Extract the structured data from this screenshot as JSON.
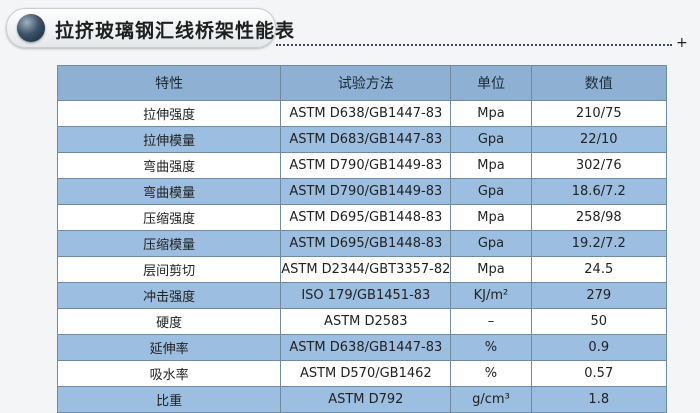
{
  "title": "拉挤玻璃钢汇线桥架性能表",
  "corner_mark": "+",
  "table": {
    "headers": [
      "特性",
      "试验方法",
      "单位",
      "数值"
    ],
    "rows": [
      {
        "property": "拉伸强度",
        "method": "ASTM  D638/GB1447-83",
        "unit": "Mpa",
        "value": "210/75"
      },
      {
        "property": "拉伸模量",
        "method": "ASTM  D683/GB1447-83",
        "unit": "Gpa",
        "value": "22/10"
      },
      {
        "property": "弯曲强度",
        "method": "ASTM  D790/GB1449-83",
        "unit": "Mpa",
        "value": "302/76"
      },
      {
        "property": "弯曲模量",
        "method": "ASTM  D790/GB1449-83",
        "unit": "Gpa",
        "value": "18.6/7.2"
      },
      {
        "property": "压缩强度",
        "method": "ASTM  D695/GB1448-83",
        "unit": "Mpa",
        "value": "258/98"
      },
      {
        "property": "压缩模量",
        "method": "ASTM  D695/GB1448-83",
        "unit": "Gpa",
        "value": "19.2/7.2"
      },
      {
        "property": "层间剪切",
        "method": "ASTM  D2344/GBT3357-82",
        "unit": "Mpa",
        "value": "24.5"
      },
      {
        "property": "冲击强度",
        "method": "ISO 179/GB1451-83",
        "unit": "KJ/m²",
        "value": "279"
      },
      {
        "property": "硬度",
        "method": "ASTM  D2583",
        "unit": "–",
        "value": "50"
      },
      {
        "property": "延伸率",
        "method": "ASTM  D638/GB1447-83",
        "unit": "%",
        "value": "0.9"
      },
      {
        "property": "吸水率",
        "method": "ASTM  D570/GB1462",
        "unit": "%",
        "value": "0.57"
      },
      {
        "property": "比重",
        "method": "ASTM D792",
        "unit": "g/cm³",
        "value": "1.8"
      }
    ]
  },
  "colors": {
    "header_bg": "#8db0d3",
    "row_alt_bg": "#9cbee0",
    "row_bg": "#ffffff",
    "border": "#6f8aa3"
  }
}
